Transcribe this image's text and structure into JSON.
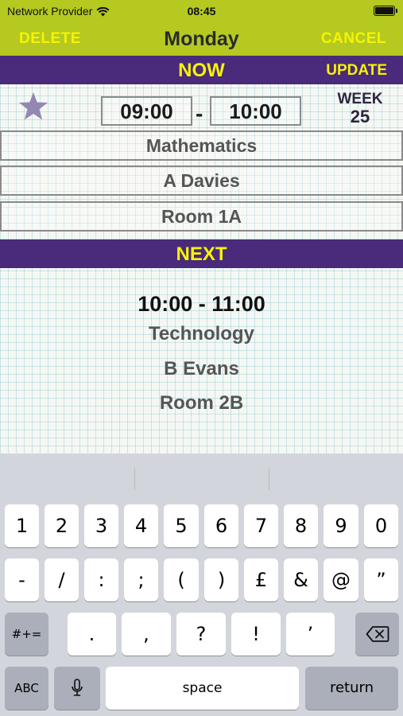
{
  "status": {
    "carrier": "Network Provider",
    "time": "08:45"
  },
  "nav": {
    "left": "DELETE",
    "title": "Monday",
    "right": "CANCEL"
  },
  "now": {
    "label": "NOW",
    "update": "UPDATE",
    "start": "09:00",
    "dash": "-",
    "end": "10:00",
    "week_label": "WEEK",
    "week_number": "25",
    "subject": "Mathematics",
    "teacher": "A Davies",
    "room": "Room 1A"
  },
  "next": {
    "label": "NEXT",
    "time": "10:00 - 11:00",
    "subject": "Technology",
    "teacher": "B Evans",
    "room": "Room 2B"
  },
  "keyboard": {
    "row1": [
      "1",
      "2",
      "3",
      "4",
      "5",
      "6",
      "7",
      "8",
      "9",
      "0"
    ],
    "row2": [
      "-",
      "/",
      ":",
      ";",
      "(",
      ")",
      "£",
      "&",
      "@",
      "”"
    ],
    "row3": [
      ".",
      ",",
      "?",
      "!",
      "’"
    ],
    "symbols": "#+=",
    "abc": "ABC",
    "space": "space",
    "return": "return"
  },
  "colors": {
    "accent": "#b5c920",
    "band": "#4a2a7a",
    "highlight": "#f6f400"
  }
}
